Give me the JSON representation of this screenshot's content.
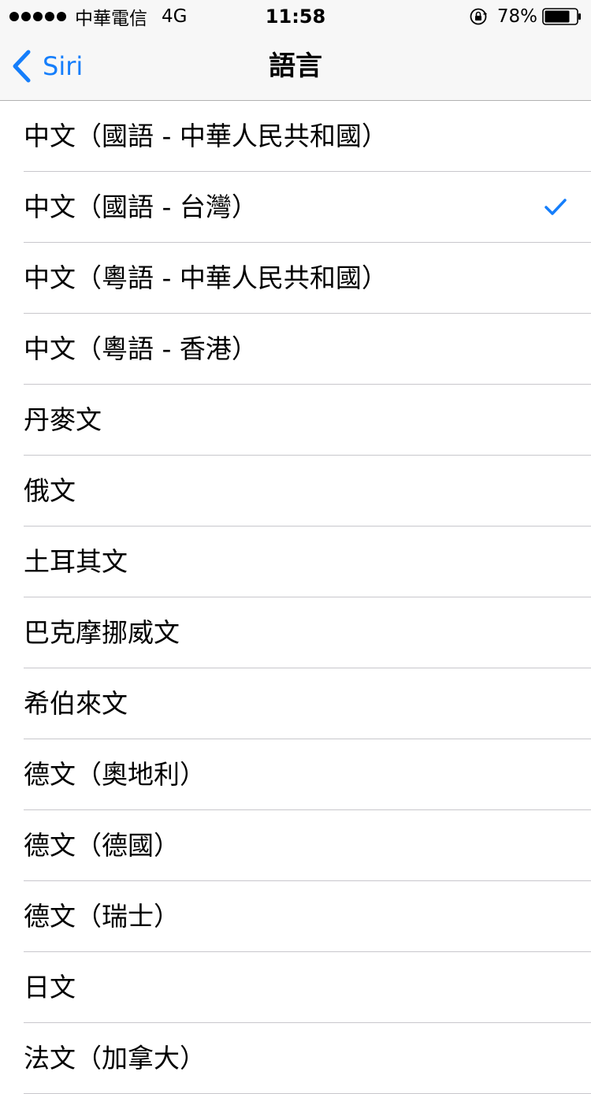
{
  "status_bar": {
    "carrier": "中華電信",
    "network": "4G",
    "time": "11:58",
    "battery_percent": "78%",
    "icons": [
      "signal-dots-icon",
      "orientation-lock-icon",
      "battery-icon"
    ]
  },
  "nav": {
    "back_label": "Siri",
    "title": "語言"
  },
  "languages": [
    {
      "label": "中文（國語 - 中華人民共和國）",
      "selected": false
    },
    {
      "label": "中文（國語 - 台灣）",
      "selected": true
    },
    {
      "label": "中文（粵語 - 中華人民共和國）",
      "selected": false
    },
    {
      "label": "中文（粵語 - 香港）",
      "selected": false
    },
    {
      "label": "丹麥文",
      "selected": false
    },
    {
      "label": "俄文",
      "selected": false
    },
    {
      "label": "土耳其文",
      "selected": false
    },
    {
      "label": "巴克摩挪威文",
      "selected": false
    },
    {
      "label": "希伯來文",
      "selected": false
    },
    {
      "label": "德文（奧地利）",
      "selected": false
    },
    {
      "label": "德文（德國）",
      "selected": false
    },
    {
      "label": "德文（瑞士）",
      "selected": false
    },
    {
      "label": "日文",
      "selected": false
    },
    {
      "label": "法文（加拿大）",
      "selected": false
    }
  ],
  "colors": {
    "accent": "#157efb",
    "separator": "#c8c7cc",
    "bar_background": "#f7f7f7"
  }
}
